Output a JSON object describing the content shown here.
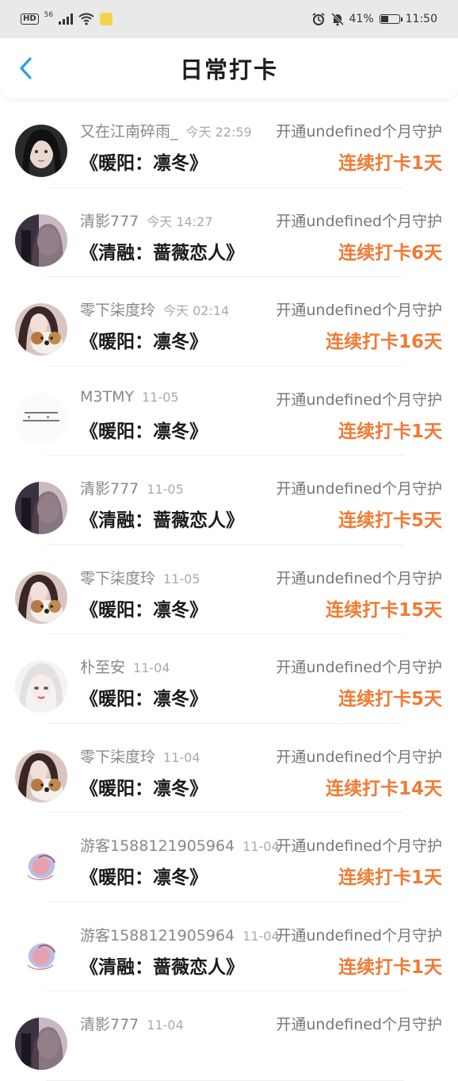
{
  "status_bar": {
    "network": "56",
    "battery": "41%",
    "time": "11:50"
  },
  "header": {
    "title": "日常打卡"
  },
  "colors": {
    "accent": "#f07a34",
    "back": "#2aa0e6"
  },
  "items": [
    {
      "name": "又在江南碎雨_",
      "time": "今天 22:59",
      "guard": "开通undefined个月守护",
      "book": "《暖阳：凛冬》",
      "streak": "连续打卡1天",
      "avatar": "dark-hair-girl"
    },
    {
      "name": "清影777",
      "time": "今天 14:27",
      "guard": "开通undefined个月守护",
      "book": "《清融：蔷薇恋人》",
      "streak": "连续打卡6天",
      "avatar": "blurred-girl"
    },
    {
      "name": "零下柒度玲",
      "time": "今天 02:14",
      "guard": "开通undefined个月守护",
      "book": "《暖阳：凛冬》",
      "streak": "连续打卡16天",
      "avatar": "girl-with-dog"
    },
    {
      "name": "M3TMY",
      "time": "11-05",
      "guard": "开通undefined个月守护",
      "book": "《暖阳：凛冬》",
      "streak": "连续打卡1天",
      "avatar": "text-avatar"
    },
    {
      "name": "清影777",
      "time": "11-05",
      "guard": "开通undefined个月守护",
      "book": "《清融：蔷薇恋人》",
      "streak": "连续打卡5天",
      "avatar": "blurred-girl"
    },
    {
      "name": "零下柒度玲",
      "time": "11-05",
      "guard": "开通undefined个月守护",
      "book": "《暖阳：凛冬》",
      "streak": "连续打卡15天",
      "avatar": "girl-with-dog"
    },
    {
      "name": "朴至安",
      "time": "11-04",
      "guard": "开通undefined个月守护",
      "book": "《暖阳：凛冬》",
      "streak": "连续打卡5天",
      "avatar": "white-hair-girl"
    },
    {
      "name": "零下柒度玲",
      "time": "11-04",
      "guard": "开通undefined个月守护",
      "book": "《暖阳：凛冬》",
      "streak": "连续打卡14天",
      "avatar": "girl-with-dog"
    },
    {
      "name": "游客1588121905964",
      "time": "11-04",
      "guard": "开通undefined个月守护",
      "book": "《暖阳：凛冬》",
      "streak": "连续打卡1天",
      "avatar": "guest-logo"
    },
    {
      "name": "游客1588121905964",
      "time": "11-04",
      "guard": "开通undefined个月守护",
      "book": "《清融：蔷薇恋人》",
      "streak": "连续打卡1天",
      "avatar": "guest-logo"
    },
    {
      "name": "清影777",
      "time": "11-04",
      "guard": "开通undefined个月守护",
      "book": "",
      "streak": "",
      "avatar": "blurred-girl"
    }
  ]
}
